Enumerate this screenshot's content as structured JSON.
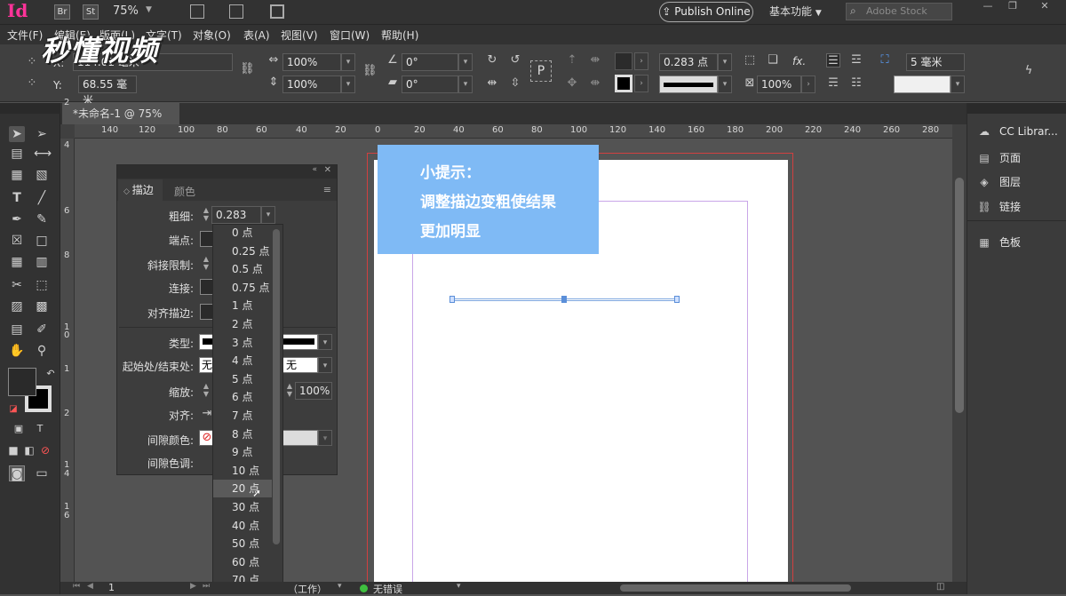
{
  "app": {
    "logo": "Id",
    "bridge": "Br",
    "stock_label": "St",
    "zoom": "75%",
    "publish": "Publish Online",
    "workspace": "基本功能",
    "search_placeholder": "Adobe Stock"
  },
  "menu": [
    "文件(F)",
    "编辑(E)",
    "版面(L)",
    "文字(T)",
    "对象(O)",
    "表(A)",
    "视图(V)",
    "窗口(W)",
    "帮助(H)"
  ],
  "watermark": "秒懂视频",
  "control": {
    "x_label": "X:",
    "x_value": "114.01 毫米",
    "y_label": "Y:",
    "y_value": "68.55 毫米",
    "scale_x": "100%",
    "scale_y": "100%",
    "angle": "0°",
    "shear": "0°",
    "stroke_weight": "0.283 点",
    "opacity": "100%",
    "p_label": "P",
    "offset": "5 毫米",
    "fx": "fx."
  },
  "document": {
    "tab": "*未命名-1 @ 75%",
    "close": "×"
  },
  "ruler": {
    "h_ticks": [
      "140",
      "120",
      "100",
      "80",
      "60",
      "40",
      "20",
      "0",
      "20",
      "40",
      "60",
      "80",
      "100",
      "120",
      "140",
      "160",
      "180",
      "200",
      "220",
      "240",
      "260",
      "280"
    ],
    "v_ticks": [
      "0",
      "2",
      "4",
      "6",
      "8",
      "1",
      "0",
      "1",
      "2",
      "1",
      "4",
      "1",
      "6"
    ]
  },
  "tip": {
    "line1": "小提示：",
    "line2": "调整描边变粗使结果",
    "line3": "更加明显"
  },
  "right_panel": {
    "items": [
      {
        "icon": "cc-libraries-icon",
        "label": "CC Librar..."
      },
      {
        "icon": "pages-icon",
        "label": "页面"
      },
      {
        "icon": "layers-icon",
        "label": "图层"
      },
      {
        "icon": "links-icon",
        "label": "链接"
      },
      {
        "icon": "swatches-icon",
        "label": "色板"
      }
    ]
  },
  "stroke_panel": {
    "tab_stroke": "描边",
    "tab_color": "颜色",
    "weight_label": "粗细:",
    "weight_value": "0.283 点",
    "cap_label": "端点:",
    "miter_label": "斜接限制:",
    "join_label": "连接:",
    "align_label": "对齐描边:",
    "type_label": "类型:",
    "start_end_label": "起始处/结束处:",
    "start_value": "无",
    "end_value": "无",
    "scale_label": "缩放:",
    "scale_value": "100%",
    "align2_label": "对齐:",
    "gap_color_label": "间隙颜色:",
    "gap_tint_label": "间隙色调:"
  },
  "weight_options": [
    "0 点",
    "0.25 点",
    "0.5 点",
    "0.75 点",
    "1 点",
    "2 点",
    "3 点",
    "4 点",
    "5 点",
    "6 点",
    "7 点",
    "8 点",
    "9 点",
    "10 点",
    "20 点",
    "30 点",
    "40 点",
    "50 点",
    "60 点",
    "70 点"
  ],
  "highlighted_option": "20 点",
  "status": {
    "page": "1",
    "workspace": "（工作）",
    "preflight": "无错误"
  },
  "colors": {
    "accent_tip": "#7fbaf5",
    "logo": "#ff3399",
    "status_ok": "#3fbf3f"
  }
}
